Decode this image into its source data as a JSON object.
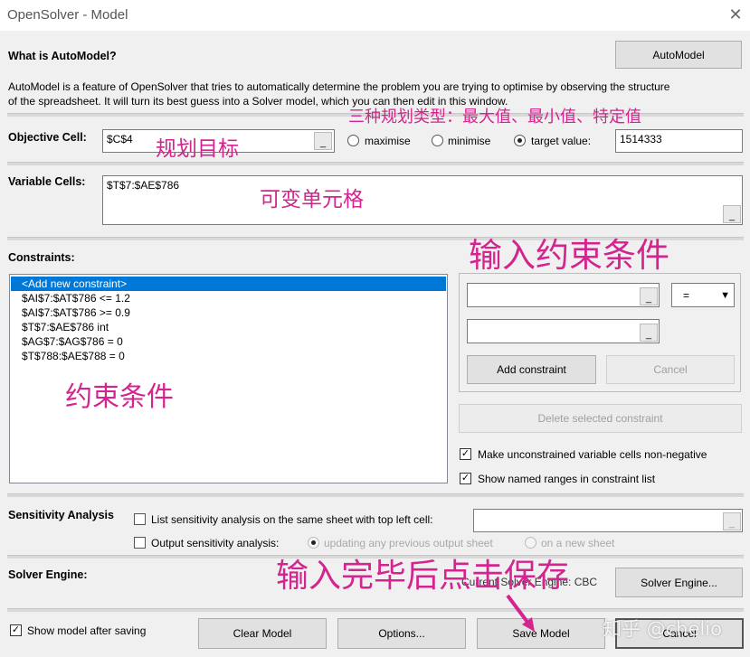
{
  "window": {
    "title": "OpenSolver - Model",
    "close_glyph": "✕"
  },
  "automodel": {
    "heading": "What is AutoModel?",
    "button": "AutoModel",
    "description_line1": "AutoModel is a feature of OpenSolver that tries to automatically determine the problem you are trying to optimise by observing the structure",
    "description_line2": "of the spreadsheet. It will turn its best guess into a Solver model, which you can then edit in this window."
  },
  "objective": {
    "label": "Objective Cell:",
    "value": "$C$4",
    "options": [
      {
        "label": "maximise",
        "selected": false
      },
      {
        "label": "minimise",
        "selected": false
      },
      {
        "label": "target value:",
        "selected": true
      }
    ],
    "target_value": "1514333"
  },
  "variables": {
    "label": "Variable Cells:",
    "value": "$T$7:$AE$786"
  },
  "constraints": {
    "label": "Constraints:",
    "items": [
      "<Add new constraint>",
      "$AI$7:$AT$786 <= 1.2",
      "$AI$7:$AT$786 >= 0.9",
      "$T$7:$AE$786 int",
      "$AG$7:$AG$786 = 0",
      "$T$788:$AE$788 = 0"
    ],
    "selected_index": 0,
    "relation_value": "=",
    "add_button": "Add constraint",
    "cancel_button": "Cancel",
    "delete_button": "Delete selected constraint",
    "nonneg_label": "Make unconstrained variable cells non-negative",
    "nonneg_checked": true,
    "named_ranges_label": "Show named ranges in constraint list",
    "named_ranges_checked": true
  },
  "sensitivity": {
    "label": "Sensitivity Analysis",
    "list_label": "List sensitivity analysis on the same sheet with top left cell:",
    "output_label": "Output sensitivity analysis:",
    "updating_label": "updating any previous output sheet",
    "new_sheet_label": "on a new sheet"
  },
  "solver": {
    "label": "Solver Engine:",
    "current_label": "Current Solver Engine: CBC",
    "button": "Solver Engine..."
  },
  "footer": {
    "show_model_label": "Show model after saving",
    "show_model_checked": true,
    "clear_button": "Clear Model",
    "options_button": "Options...",
    "save_button": "Save Model",
    "cancel_button": "Cancel"
  },
  "annotations": {
    "types": "三种规划类型：最大值、最小值、特定值",
    "objective": "规划目标",
    "variable": "可变单元格",
    "input_constraints": "输入约束条件",
    "constraints": "约束条件",
    "save": "输入完毕后点击保存",
    "watermark": "知乎 @chelio"
  },
  "colors": {
    "annotation": "#d4248f",
    "selection": "#0078d7"
  }
}
